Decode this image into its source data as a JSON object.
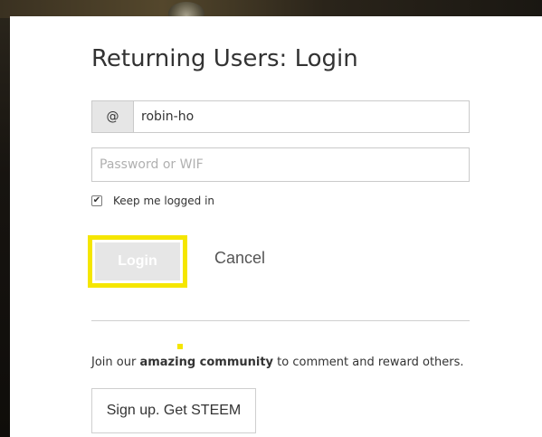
{
  "modal": {
    "title": "Returning Users: Login",
    "username": {
      "prefix": "@",
      "value": "robin-ho"
    },
    "password": {
      "placeholder": "Password or WIF"
    },
    "keep_logged_in": {
      "label": "Keep me logged in",
      "checked": true
    },
    "login_label": "Login",
    "cancel_label": "Cancel",
    "join": {
      "prefix": "Join our ",
      "emphasis": "amazing community",
      "suffix": " to comment and reward others."
    },
    "signup_label": "Sign up. Get STEEM"
  },
  "colors": {
    "highlight": "#f5e600",
    "login_bg": "#e6e6e6",
    "text": "#333333"
  }
}
